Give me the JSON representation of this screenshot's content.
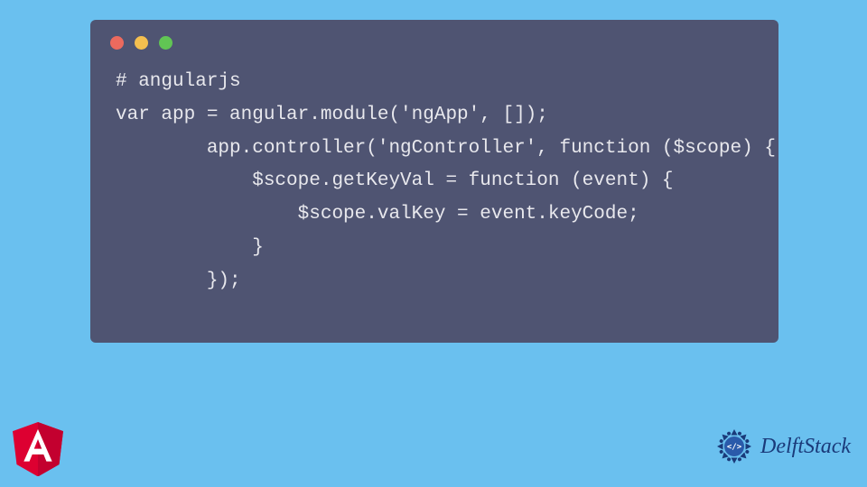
{
  "window": {
    "traffic_lights": {
      "red": "#ec6a5e",
      "yellow": "#f4bf4f",
      "green": "#61c554"
    }
  },
  "code": {
    "lines": [
      "# angularjs",
      "var app = angular.module('ngApp', []);",
      "        app.controller('ngController', function ($scope) {",
      "            $scope.getKeyVal = function (event) {",
      "                $scope.valKey = event.keyCode;",
      "            }",
      "        });"
    ],
    "full": "# angularjs\nvar app = angular.module('ngApp', []);\n        app.controller('ngController', function ($scope) {\n            $scope.getKeyVal = function (event) {\n                $scope.valKey = event.keyCode;\n            }\n        });"
  },
  "logos": {
    "angular_label": "A",
    "delftstack_label": "DelftStack"
  },
  "colors": {
    "background": "#6ac0ef",
    "window_bg": "#4f5472",
    "code_text": "#e8e8ed",
    "angular_red": "#dd0031",
    "angular_dark": "#c3002f",
    "delft_blue": "#1a3a7a"
  }
}
